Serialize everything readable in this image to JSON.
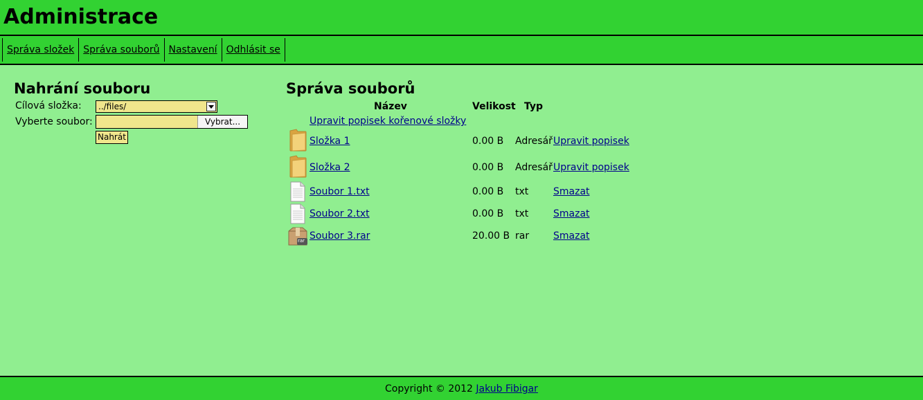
{
  "header": {
    "title": "Administrace"
  },
  "nav": {
    "items": [
      "Správa složek",
      "Správa souborů",
      "Nastavení",
      "Odhlásit se"
    ]
  },
  "upload": {
    "title": "Nahrání souboru",
    "target_label": "Cílová složka:",
    "target_value": "../files/",
    "file_label": "Vyberte soubor:",
    "browse_label": "Vybrat...",
    "submit_label": "Nahrát"
  },
  "files": {
    "title": "Správa souborů",
    "headers": {
      "name": "Název",
      "size": "Velikost",
      "type": "Typ"
    },
    "root_link": "Upravit popisek kořenové složky",
    "rows": [
      {
        "icon": "folder-icon",
        "name": "Složka 1",
        "size": "0.00 B",
        "type": "Adresář",
        "action": "Upravit popisek"
      },
      {
        "icon": "folder-icon",
        "name": "Složka 2",
        "size": "0.00 B",
        "type": "Adresář",
        "action": "Upravit popisek"
      },
      {
        "icon": "text-file-icon",
        "name": "Soubor 1.txt",
        "size": "0.00 B",
        "type": "txt",
        "action": "Smazat"
      },
      {
        "icon": "text-file-icon",
        "name": "Soubor 2.txt",
        "size": "0.00 B",
        "type": "txt",
        "action": "Smazat"
      },
      {
        "icon": "rar-archive-icon",
        "name": "Soubor 3.rar",
        "size": "20.00 B",
        "type": "rar",
        "action": "Smazat"
      }
    ]
  },
  "footer": {
    "copyright": "Copyright © 2012",
    "author": "Jakub Fibigar"
  },
  "colors": {
    "bar": "#32d232",
    "background": "#90ee90",
    "input": "#f0e68c",
    "link": "#00008b"
  }
}
